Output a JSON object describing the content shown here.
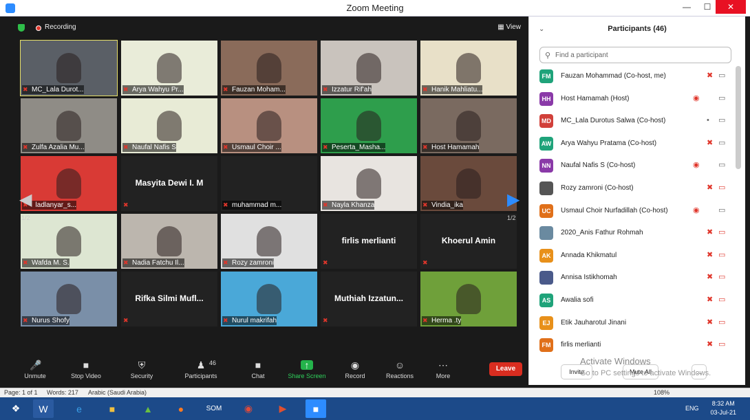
{
  "window": {
    "title": "Zoom Meeting"
  },
  "meeting": {
    "recording_label": "Recording",
    "view_label": "View",
    "page_indicator_left": "1/2",
    "page_indicator_right": "1/2",
    "tiles": [
      {
        "name": "MC_Lala Durot...",
        "type": "video",
        "bg": "#5a5f66",
        "active": true
      },
      {
        "name": "Arya Wahyu Pr...",
        "type": "video",
        "bg": "#e9ecd9"
      },
      {
        "name": "Fauzan Moham...",
        "type": "video",
        "bg": "#8a6b5a"
      },
      {
        "name": "Izzatur Rif'ah",
        "type": "video",
        "bg": "#c9c3bd"
      },
      {
        "name": "Hanik Mahliatu...",
        "type": "video",
        "bg": "#e8e0c8"
      },
      {
        "name": "Zulfa Azalia Mu...",
        "type": "video",
        "bg": "#8f8c86"
      },
      {
        "name": "Naufal Nafis S",
        "type": "video",
        "bg": "#e8ebd6"
      },
      {
        "name": "Usmaul Choir ...",
        "type": "video",
        "bg": "#b89080"
      },
      {
        "name": "Peserta_Masha...",
        "type": "video",
        "bg": "#2e9e4c"
      },
      {
        "name": "Host Hamamah",
        "type": "video",
        "bg": "#7a6a60"
      },
      {
        "name": "  ladlanyar_s...",
        "type": "video",
        "bg": "#d93a35"
      },
      {
        "name": "Masyita Dewi I. M",
        "type": "name"
      },
      {
        "name": "muhammad m...",
        "type": "empty"
      },
      {
        "name": "Nayla Khanza",
        "type": "video",
        "bg": "#e8e4e0"
      },
      {
        "name": "Vindia_ika",
        "type": "video",
        "bg": "#6a4a3c"
      },
      {
        "name": "Wafda M. S.",
        "type": "video",
        "bg": "#dde6d2"
      },
      {
        "name": "Nadia Fatchu Il...",
        "type": "video",
        "bg": "#bcb6ae"
      },
      {
        "name": "Rozy zamroni",
        "type": "video",
        "bg": "#e0e0e0"
      },
      {
        "name": "firlis merlianti",
        "type": "name"
      },
      {
        "name": "Khoerul Amin",
        "type": "name"
      },
      {
        "name": "Nurus Shofy",
        "type": "video",
        "bg": "#7a8fa8"
      },
      {
        "name": "Rifka  Silmi  Mufl...",
        "type": "name"
      },
      {
        "name": "Nurul makrifah",
        "type": "video",
        "bg": "#4aa8d8"
      },
      {
        "name": "Muthiah  Izzatun...",
        "type": "name"
      },
      {
        "name": "Herma .ty",
        "type": "video",
        "bg": "#6fa03a"
      }
    ]
  },
  "toolbar": {
    "unmute": "Unmute",
    "stop_video": "Stop Video",
    "security": "Security",
    "participants": "Participants",
    "participants_count": "46",
    "chat": "Chat",
    "share_screen": "Share Screen",
    "record": "Record",
    "reactions": "Reactions",
    "more": "More",
    "leave": "Leave"
  },
  "panel": {
    "title": "Participants (46)",
    "search_placeholder": "Find a participant",
    "invite": "Invite",
    "mute_all": "Mute All",
    "more_btn": "...",
    "activate_title": "Activate Windows",
    "activate_sub": "Go to PC settings to activate Windows.",
    "participants": [
      {
        "initials": "FM",
        "name": "Fauzan Mohammad (Co-host, me)",
        "color": "#1fa37a",
        "mic": "muted",
        "rec": false,
        "cam": "on"
      },
      {
        "initials": "HH",
        "name": "Host Hamamah (Host)",
        "color": "#8a3aa8",
        "mic": "none",
        "rec": true,
        "cam": "on"
      },
      {
        "initials": "MD",
        "name": "MC_Lala Durotus Salwa (Co-host)",
        "color": "#d1403a",
        "mic": "on",
        "rec": false,
        "cam": "on"
      },
      {
        "initials": "AW",
        "name": "Arya Wahyu Pratama (Co-host)",
        "color": "#1fa37a",
        "mic": "muted",
        "rec": false,
        "cam": "on"
      },
      {
        "initials": "NN",
        "name": "Naufal Nafis S (Co-host)",
        "color": "#8a3aa8",
        "mic": "none",
        "rec": true,
        "cam": "on"
      },
      {
        "initials": "",
        "name": "Rozy zamroni (Co-host)",
        "color": "#555555",
        "mic": "muted",
        "rec": false,
        "cam": "off"
      },
      {
        "initials": "UC",
        "name": "Usmaul Choir Nurfadillah (Co-host)",
        "color": "#e0701a",
        "mic": "none",
        "rec": true,
        "cam": "on"
      },
      {
        "initials": "",
        "name": "2020_Anis Fathur Rohmah",
        "color": "#6a8aa0",
        "mic": "muted",
        "rec": false,
        "cam": "off"
      },
      {
        "initials": "AK",
        "name": "Annada Khikmatul",
        "color": "#e8901a",
        "mic": "muted",
        "rec": false,
        "cam": "off"
      },
      {
        "initials": "",
        "name": "Annisa Istikhomah",
        "color": "#4a5a8a",
        "mic": "muted",
        "rec": false,
        "cam": "off"
      },
      {
        "initials": "AS",
        "name": "Awalia sofi",
        "color": "#1fa37a",
        "mic": "muted",
        "rec": false,
        "cam": "off"
      },
      {
        "initials": "EJ",
        "name": "Etik Jauharotul Jinani",
        "color": "#e8901a",
        "mic": "muted",
        "rec": false,
        "cam": "off"
      },
      {
        "initials": "FM",
        "name": "firlis merlianti",
        "color": "#e0701a",
        "mic": "muted",
        "rec": false,
        "cam": "off"
      }
    ]
  },
  "statusbar": {
    "page": "Page: 1 of 1",
    "words": "Words: 217",
    "language": "Arabic (Saudi Arabia)",
    "zoom": "108%"
  },
  "taskbar": {
    "icons": [
      "start-icon",
      "word-icon",
      "ie-icon",
      "explorer-icon",
      "app-icon",
      "firefox-icon",
      "som-icon",
      "chrome-icon",
      "media-icon",
      "zoom-icon"
    ],
    "lang": "ENG",
    "time": "8:32 AM",
    "date": "03-Jul-21"
  }
}
